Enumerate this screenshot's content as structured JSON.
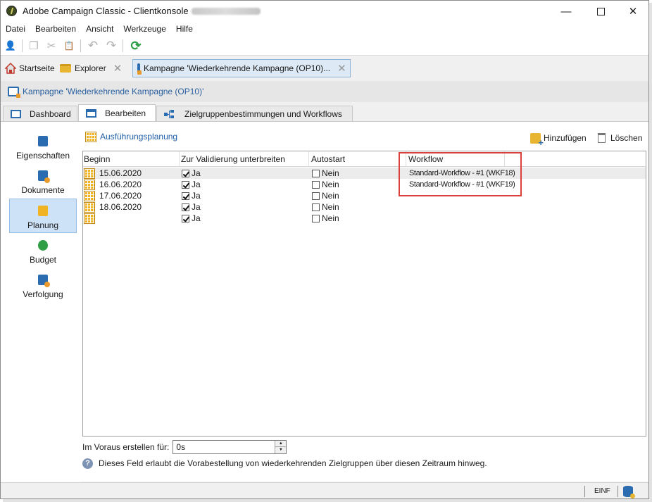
{
  "window": {
    "title": "Adobe Campaign Classic - Clientkonsole",
    "minimize_glyph": "—",
    "close_glyph": "✕"
  },
  "menu": [
    "Datei",
    "Bearbeiten",
    "Ansicht",
    "Werkzeuge",
    "Hilfe"
  ],
  "toolbar": {
    "icons": [
      "new-user-icon",
      "copy-icon",
      "cut-icon",
      "paste-icon",
      "undo-icon",
      "redo-icon",
      "refresh-icon"
    ],
    "glyphs": {
      "new": "👤",
      "copy": "❐",
      "cut": "✂",
      "paste": "📋",
      "undo": "↶",
      "redo": "↷",
      "refresh": "⟳"
    }
  },
  "doc_tabs": {
    "home": "Startseite",
    "explorer": "Explorer",
    "campaign": "Kampagne 'Wiederkehrende Kampagne (OP10)...",
    "close_glyph": "✕"
  },
  "breadcrumb": "Kampagne 'Wiederkehrende Kampagne (OP10)'",
  "subtabs": {
    "dashboard": "Dashboard",
    "edit": "Bearbeiten",
    "targeting": "Zielgruppenbestimmungen und Workflows"
  },
  "leftnav": [
    "Eigenschaften",
    "Dokumente",
    "Planung",
    "Budget",
    "Verfolgung"
  ],
  "panel": {
    "title": "Ausführungsplanung",
    "add": "Hinzufügen",
    "delete": "Löschen"
  },
  "grid": {
    "columns": [
      "Beginn",
      "Zur Validierung unterbreiten",
      "Autostart",
      "Workflow"
    ],
    "rows": [
      {
        "date": "15.06.2020",
        "validate": "Ja",
        "validate_checked": true,
        "autostart": "Nein",
        "autostart_checked": false,
        "workflow": "Standard-Workflow - #1 (WKF18)"
      },
      {
        "date": "16.06.2020",
        "validate": "Ja",
        "validate_checked": true,
        "autostart": "Nein",
        "autostart_checked": false,
        "workflow": "Standard-Workflow - #1 (WKF19)"
      },
      {
        "date": "17.06.2020",
        "validate": "Ja",
        "validate_checked": true,
        "autostart": "Nein",
        "autostart_checked": false,
        "workflow": ""
      },
      {
        "date": "18.06.2020",
        "validate": "Ja",
        "validate_checked": true,
        "autostart": "Nein",
        "autostart_checked": false,
        "workflow": ""
      },
      {
        "date": "",
        "validate": "Ja",
        "validate_checked": true,
        "autostart": "Nein",
        "autostart_checked": false,
        "workflow": ""
      }
    ]
  },
  "advance": {
    "label": "Im Voraus erstellen für:",
    "value": "0s",
    "up_glyph": "▲",
    "down_glyph": "▼"
  },
  "hint": {
    "icon_glyph": "?",
    "text": "Dieses Feld erlaubt die Vorabestellung von wiederkehrenden Zielgruppen über diesen Zeitraum hinweg."
  },
  "statusbar": {
    "mode": "EINF"
  },
  "colors": {
    "accent": "#2b6cb0",
    "selection": "#cde2f6",
    "highlight_border": "#d9413a",
    "calendar": "#f0b323"
  }
}
